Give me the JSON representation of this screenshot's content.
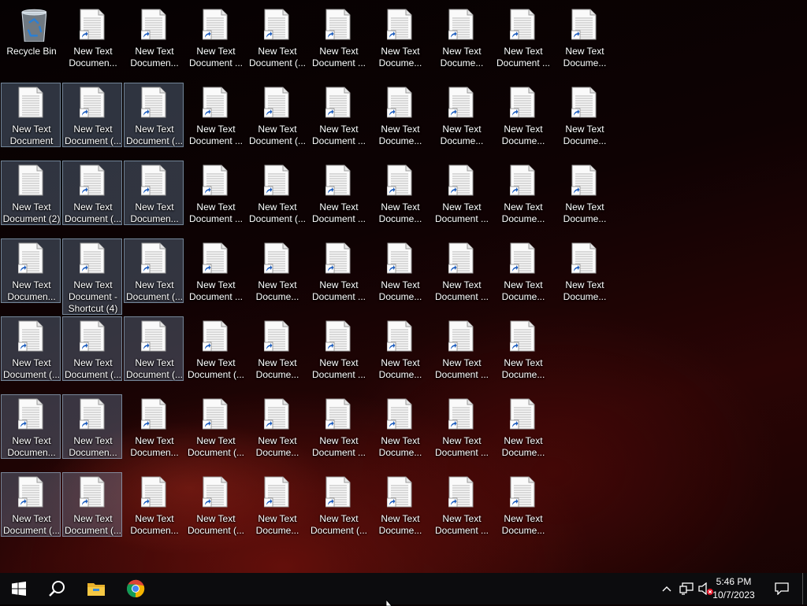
{
  "desktop": {
    "recycle_bin_label": "Recycle Bin",
    "icons": [
      {
        "c": 1,
        "r": 0,
        "sc": true,
        "l1": "New Text",
        "l2": "Documen..."
      },
      {
        "c": 2,
        "r": 0,
        "sc": true,
        "l1": "New Text",
        "l2": "Documen..."
      },
      {
        "c": 3,
        "r": 0,
        "sc": true,
        "l1": "New Text",
        "l2": "Document ..."
      },
      {
        "c": 4,
        "r": 0,
        "sc": true,
        "l1": "New Text",
        "l2": "Document (..."
      },
      {
        "c": 5,
        "r": 0,
        "sc": true,
        "l1": "New Text",
        "l2": "Document ..."
      },
      {
        "c": 6,
        "r": 0,
        "sc": true,
        "l1": "New Text",
        "l2": "Docume..."
      },
      {
        "c": 7,
        "r": 0,
        "sc": true,
        "l1": "New Text",
        "l2": "Docume..."
      },
      {
        "c": 8,
        "r": 0,
        "sc": true,
        "l1": "New Text",
        "l2": "Document ..."
      },
      {
        "c": 9,
        "r": 0,
        "sc": true,
        "l1": "New Text",
        "l2": "Docume..."
      },
      {
        "c": 0,
        "r": 1,
        "sc": false,
        "sel": true,
        "l1": "New Text",
        "l2": "Document"
      },
      {
        "c": 1,
        "r": 1,
        "sc": true,
        "sel": true,
        "l1": "New Text",
        "l2": "Document (..."
      },
      {
        "c": 2,
        "r": 1,
        "sc": true,
        "sel": true,
        "l1": "New Text",
        "l2": "Document (..."
      },
      {
        "c": 3,
        "r": 1,
        "sc": true,
        "l1": "New Text",
        "l2": "Document ..."
      },
      {
        "c": 4,
        "r": 1,
        "sc": true,
        "l1": "New Text",
        "l2": "Document (..."
      },
      {
        "c": 5,
        "r": 1,
        "sc": true,
        "l1": "New Text",
        "l2": "Document ..."
      },
      {
        "c": 6,
        "r": 1,
        "sc": true,
        "l1": "New Text",
        "l2": "Docume..."
      },
      {
        "c": 7,
        "r": 1,
        "sc": true,
        "l1": "New Text",
        "l2": "Docume..."
      },
      {
        "c": 8,
        "r": 1,
        "sc": true,
        "l1": "New Text",
        "l2": "Docume..."
      },
      {
        "c": 9,
        "r": 1,
        "sc": true,
        "l1": "New Text",
        "l2": "Docume..."
      },
      {
        "c": 0,
        "r": 2,
        "sc": false,
        "sel": true,
        "l1": "New Text",
        "l2": "Document (2)"
      },
      {
        "c": 1,
        "r": 2,
        "sc": true,
        "sel": true,
        "l1": "New Text",
        "l2": "Document (..."
      },
      {
        "c": 2,
        "r": 2,
        "sc": true,
        "sel": true,
        "l1": "New Text",
        "l2": "Documen..."
      },
      {
        "c": 3,
        "r": 2,
        "sc": true,
        "l1": "New Text",
        "l2": "Document ..."
      },
      {
        "c": 4,
        "r": 2,
        "sc": true,
        "l1": "New Text",
        "l2": "Document (..."
      },
      {
        "c": 5,
        "r": 2,
        "sc": true,
        "l1": "New Text",
        "l2": "Document ..."
      },
      {
        "c": 6,
        "r": 2,
        "sc": true,
        "l1": "New Text",
        "l2": "Docume..."
      },
      {
        "c": 7,
        "r": 2,
        "sc": true,
        "l1": "New Text",
        "l2": "Document ..."
      },
      {
        "c": 8,
        "r": 2,
        "sc": true,
        "l1": "New Text",
        "l2": "Docume..."
      },
      {
        "c": 9,
        "r": 2,
        "sc": true,
        "l1": "New Text",
        "l2": "Docume..."
      },
      {
        "c": 0,
        "r": 3,
        "sc": true,
        "sel": true,
        "l1": "New Text",
        "l2": "Documen..."
      },
      {
        "c": 1,
        "r": 3,
        "sc": true,
        "sel": true,
        "tall": true,
        "l1": "New Text",
        "l2": "Document -",
        "l3": "Shortcut (4)"
      },
      {
        "c": 2,
        "r": 3,
        "sc": true,
        "sel": true,
        "l1": "New Text",
        "l2": "Document (..."
      },
      {
        "c": 3,
        "r": 3,
        "sc": true,
        "l1": "New Text",
        "l2": "Document ..."
      },
      {
        "c": 4,
        "r": 3,
        "sc": true,
        "l1": "New Text",
        "l2": "Docume..."
      },
      {
        "c": 5,
        "r": 3,
        "sc": true,
        "l1": "New Text",
        "l2": "Document ..."
      },
      {
        "c": 6,
        "r": 3,
        "sc": true,
        "l1": "New Text",
        "l2": "Docume..."
      },
      {
        "c": 7,
        "r": 3,
        "sc": true,
        "l1": "New Text",
        "l2": "Document ..."
      },
      {
        "c": 8,
        "r": 3,
        "sc": true,
        "l1": "New Text",
        "l2": "Docume..."
      },
      {
        "c": 9,
        "r": 3,
        "sc": true,
        "l1": "New Text",
        "l2": "Docume..."
      },
      {
        "c": 0,
        "r": 4,
        "sc": true,
        "sel": true,
        "l1": "New Text",
        "l2": "Document (..."
      },
      {
        "c": 1,
        "r": 4,
        "sc": true,
        "sel": true,
        "l1": "New Text",
        "l2": "Document (..."
      },
      {
        "c": 2,
        "r": 4,
        "sc": true,
        "sel": true,
        "l1": "New Text",
        "l2": "Document (..."
      },
      {
        "c": 3,
        "r": 4,
        "sc": true,
        "l1": "New Text",
        "l2": "Document (..."
      },
      {
        "c": 4,
        "r": 4,
        "sc": true,
        "l1": "New Text",
        "l2": "Docume..."
      },
      {
        "c": 5,
        "r": 4,
        "sc": true,
        "l1": "New Text",
        "l2": "Document ..."
      },
      {
        "c": 6,
        "r": 4,
        "sc": true,
        "l1": "New Text",
        "l2": "Docume..."
      },
      {
        "c": 7,
        "r": 4,
        "sc": true,
        "l1": "New Text",
        "l2": "Document ..."
      },
      {
        "c": 8,
        "r": 4,
        "sc": true,
        "l1": "New Text",
        "l2": "Docume..."
      },
      {
        "c": 0,
        "r": 5,
        "sc": true,
        "sel": true,
        "l1": "New Text",
        "l2": "Documen..."
      },
      {
        "c": 1,
        "r": 5,
        "sc": true,
        "sel": true,
        "l1": "New Text",
        "l2": "Documen..."
      },
      {
        "c": 2,
        "r": 5,
        "sc": true,
        "l1": "New Text",
        "l2": "Documen..."
      },
      {
        "c": 3,
        "r": 5,
        "sc": true,
        "l1": "New Text",
        "l2": "Document (..."
      },
      {
        "c": 4,
        "r": 5,
        "sc": true,
        "l1": "New Text",
        "l2": "Docume..."
      },
      {
        "c": 5,
        "r": 5,
        "sc": true,
        "l1": "New Text",
        "l2": "Document ..."
      },
      {
        "c": 6,
        "r": 5,
        "sc": true,
        "l1": "New Text",
        "l2": "Docume..."
      },
      {
        "c": 7,
        "r": 5,
        "sc": true,
        "l1": "New Text",
        "l2": "Document ..."
      },
      {
        "c": 8,
        "r": 5,
        "sc": true,
        "l1": "New Text",
        "l2": "Docume..."
      },
      {
        "c": 0,
        "r": 6,
        "sc": true,
        "sel": true,
        "l1": "New Text",
        "l2": "Document (..."
      },
      {
        "c": 1,
        "r": 6,
        "sc": true,
        "sel": true,
        "l1": "New Text",
        "l2": "Document (..."
      },
      {
        "c": 2,
        "r": 6,
        "sc": true,
        "l1": "New Text",
        "l2": "Documen..."
      },
      {
        "c": 3,
        "r": 6,
        "sc": true,
        "l1": "New Text",
        "l2": "Document (..."
      },
      {
        "c": 4,
        "r": 6,
        "sc": true,
        "l1": "New Text",
        "l2": "Docume..."
      },
      {
        "c": 5,
        "r": 6,
        "sc": true,
        "l1": "New Text",
        "l2": "Document (..."
      },
      {
        "c": 6,
        "r": 6,
        "sc": true,
        "l1": "New Text",
        "l2": "Docume..."
      },
      {
        "c": 7,
        "r": 6,
        "sc": true,
        "l1": "New Text",
        "l2": "Document ..."
      },
      {
        "c": 8,
        "r": 6,
        "sc": true,
        "l1": "New Text",
        "l2": "Docume..."
      }
    ]
  },
  "taskbar": {
    "pinned": [
      "start-icon",
      "search-icon",
      "file-explorer-icon",
      "chrome-icon"
    ],
    "tray": [
      "chevron-up-icon",
      "network-icon",
      "volume-muted-icon"
    ],
    "time": "5:46 PM",
    "date": "10/7/2023"
  },
  "colors": {
    "selection": "#7896b4",
    "taskbar": "#0c0c0e",
    "folder": "#e8b02a",
    "start": "#ffffff"
  }
}
